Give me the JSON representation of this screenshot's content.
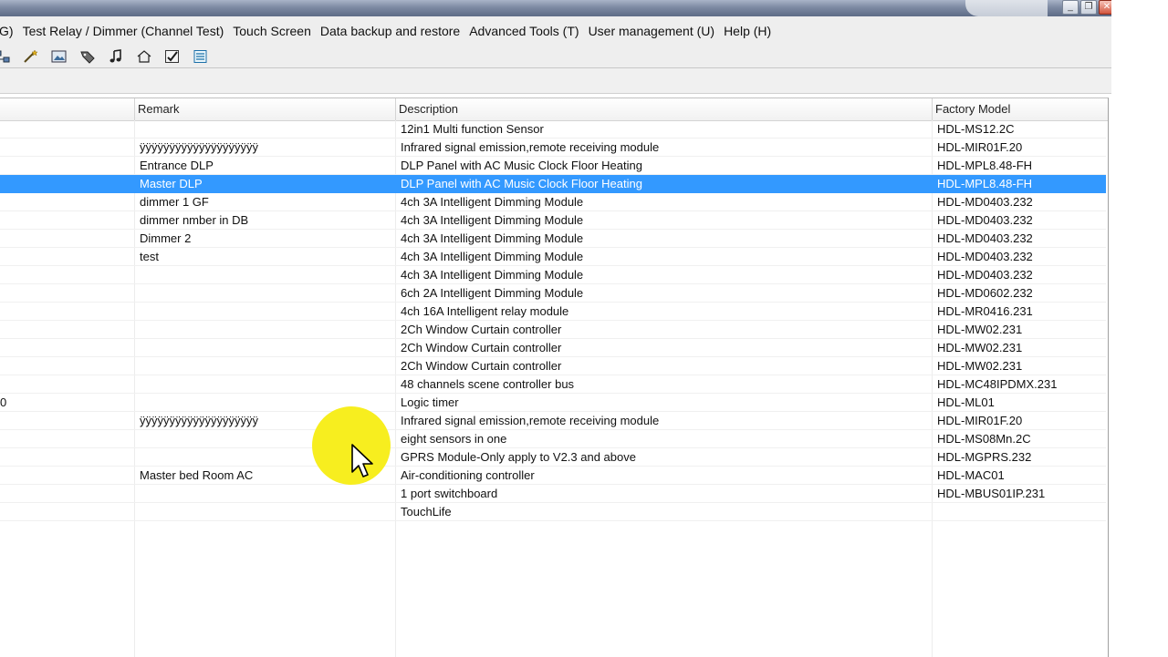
{
  "window": {
    "minimize_glyph": "_",
    "restore_glyph": "❐",
    "close_glyph": "✕"
  },
  "menu": [
    "G)",
    "Test Relay / Dimmer (Channel Test)",
    "Touch Screen",
    "Data backup and restore",
    "Advanced Tools (T)",
    "User management (U)",
    "Help (H)"
  ],
  "toolbar_icons": [
    "network-icon",
    "wand-icon",
    "image-icon",
    "tag-icon",
    "music-icon",
    "home-icon",
    "checklist-icon",
    "list-icon"
  ],
  "columns": {
    "remark": "Remark",
    "description": "Description",
    "factory_model": "Factory Model"
  },
  "rows": [
    {
      "idx": "",
      "remark": "",
      "description": "12in1 Multi function Sensor",
      "model": "HDL-MS12.2C"
    },
    {
      "idx": "",
      "remark": "ÿÿÿÿÿÿÿÿÿÿÿÿÿÿÿÿÿÿÿÿ",
      "description": "Infrared signal emission,remote receiving module",
      "model": "HDL-MIR01F.20"
    },
    {
      "idx": "",
      "remark": "Entrance DLP",
      "description": "DLP Panel with AC Music Clock Floor Heating",
      "model": "HDL-MPL8.48-FH"
    },
    {
      "idx": "",
      "remark": "Master DLP",
      "description": "DLP Panel with AC Music Clock Floor Heating",
      "model": "HDL-MPL8.48-FH",
      "selected": true
    },
    {
      "idx": "",
      "remark": "dimmer 1 GF",
      "description": "4ch 3A Intelligent Dimming Module",
      "model": "HDL-MD0403.232"
    },
    {
      "idx": "",
      "remark": "dimmer nmber in DB",
      "description": "4ch 3A Intelligent Dimming Module",
      "model": "HDL-MD0403.232"
    },
    {
      "idx": "",
      "remark": "Dimmer 2",
      "description": "4ch 3A Intelligent Dimming Module",
      "model": "HDL-MD0403.232"
    },
    {
      "idx": "",
      "remark": "test",
      "description": "4ch 3A Intelligent Dimming Module",
      "model": "HDL-MD0403.232"
    },
    {
      "idx": "",
      "remark": "",
      "description": "4ch 3A Intelligent Dimming Module",
      "model": "HDL-MD0403.232"
    },
    {
      "idx": "",
      "remark": "",
      "description": "6ch 2A Intelligent Dimming Module",
      "model": "HDL-MD0602.232"
    },
    {
      "idx": "",
      "remark": "",
      "description": "4ch 16A Intelligent  relay module",
      "model": "HDL-MR0416.231"
    },
    {
      "idx": "",
      "remark": "",
      "description": "2Ch Window Curtain controller",
      "model": "HDL-MW02.231"
    },
    {
      "idx": "",
      "remark": "",
      "description": "2Ch Window Curtain controller",
      "model": "HDL-MW02.231"
    },
    {
      "idx": "",
      "remark": "",
      "description": "2Ch Window Curtain controller",
      "model": "HDL-MW02.231"
    },
    {
      "idx": "",
      "remark": "",
      "description": "48 channels scene controller bus",
      "model": "HDL-MC48IPDMX.231"
    },
    {
      "idx": "0",
      "remark": "",
      "description": "Logic timer",
      "model": "HDL-ML01"
    },
    {
      "idx": "",
      "remark": "ÿÿÿÿÿÿÿÿÿÿÿÿÿÿÿÿÿÿÿÿ",
      "description": "Infrared signal emission,remote receiving module",
      "model": "HDL-MIR01F.20"
    },
    {
      "idx": "",
      "remark": "",
      "description": "eight sensors in one",
      "model": "HDL-MS08Mn.2C"
    },
    {
      "idx": "",
      "remark": "",
      "description": "GPRS Module-Only apply to V2.3 and above",
      "model": "HDL-MGPRS.232"
    },
    {
      "idx": "",
      "remark": "Master bed Room AC",
      "description": "Air-conditioning controller",
      "model": "HDL-MAC01"
    },
    {
      "idx": "",
      "remark": "",
      "description": "1 port switchboard",
      "model": "HDL-MBUS01IP.231"
    },
    {
      "idx": "",
      "remark": "",
      "description": "TouchLife",
      "model": ""
    }
  ]
}
